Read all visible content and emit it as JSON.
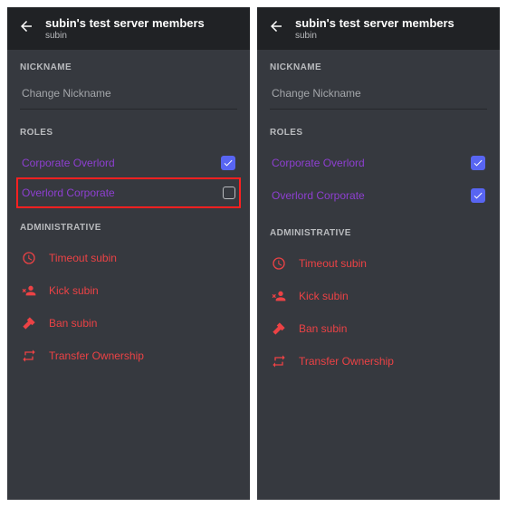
{
  "panels": [
    {
      "header": {
        "title": "subin's test server members",
        "subtitle": "subin"
      },
      "nickname": {
        "label": "NICKNAME",
        "placeholder": "Change Nickname"
      },
      "roles": {
        "label": "ROLES",
        "items": [
          {
            "name": "Corporate Overlord",
            "checked": true,
            "highlight": false
          },
          {
            "name": "Overlord Corporate",
            "checked": false,
            "highlight": true
          }
        ]
      },
      "admin": {
        "label": "ADMINISTRATIVE",
        "items": [
          {
            "icon": "clock",
            "label": "Timeout subin"
          },
          {
            "icon": "kick",
            "label": "Kick subin"
          },
          {
            "icon": "ban",
            "label": "Ban subin"
          },
          {
            "icon": "transfer",
            "label": "Transfer Ownership"
          }
        ]
      }
    },
    {
      "header": {
        "title": "subin's test server members",
        "subtitle": "subin"
      },
      "nickname": {
        "label": "NICKNAME",
        "placeholder": "Change Nickname"
      },
      "roles": {
        "label": "ROLES",
        "items": [
          {
            "name": "Corporate Overlord",
            "checked": true,
            "highlight": false
          },
          {
            "name": "Overlord Corporate",
            "checked": true,
            "highlight": false
          }
        ]
      },
      "admin": {
        "label": "ADMINISTRATIVE",
        "items": [
          {
            "icon": "clock",
            "label": "Timeout subin"
          },
          {
            "icon": "kick",
            "label": "Kick subin"
          },
          {
            "icon": "ban",
            "label": "Ban subin"
          },
          {
            "icon": "transfer",
            "label": "Transfer Ownership"
          }
        ]
      }
    }
  ]
}
